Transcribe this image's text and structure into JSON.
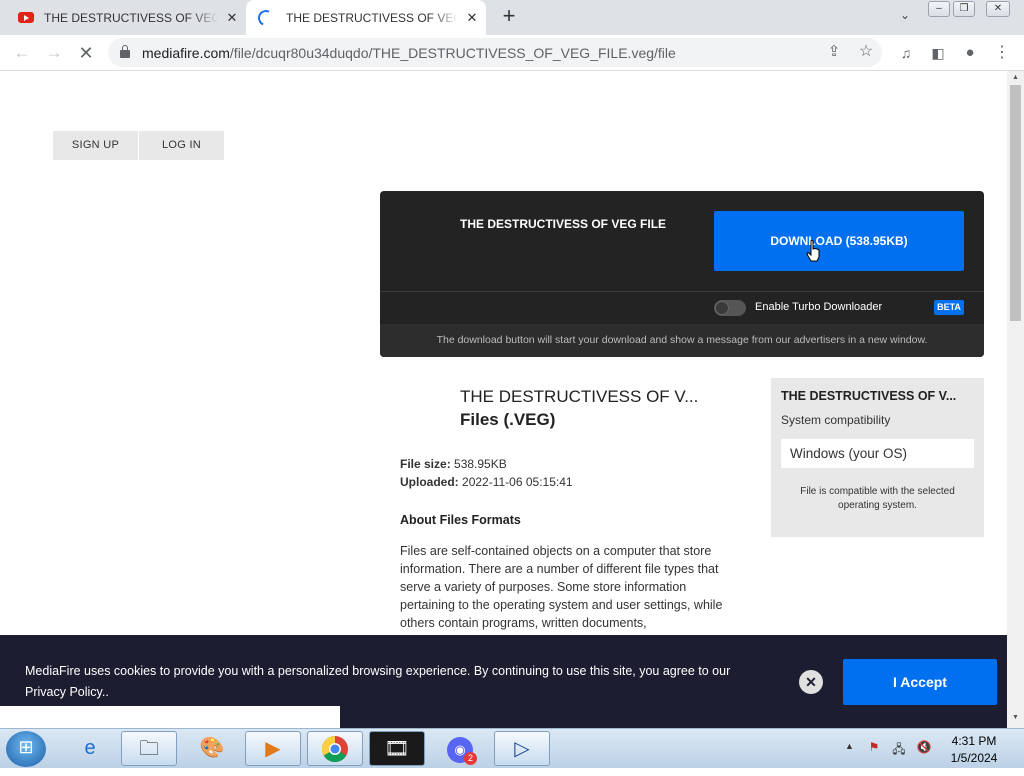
{
  "browser": {
    "tabs": [
      {
        "title": "THE DESTRUCTIVESS OF VEG FILE"
      },
      {
        "title": "THE DESTRUCTIVESS OF VEG FILE"
      }
    ],
    "url_host": "mediafire.com",
    "url_path": "/file/dcuqr80u34duqdo/THE_DESTRUCTIVESS_OF_VEG_FILE.veg/file"
  },
  "page": {
    "auth": {
      "signup": "SIGN UP",
      "login": "LOG IN"
    },
    "download_card": {
      "title": "THE DESTRUCTIVESS OF VEG FILE",
      "button": "DOWNLOAD (538.95KB)",
      "turbo_label": "Enable Turbo Downloader",
      "beta": "BETA",
      "note": "The download button will start your download and show a message from our advertisers in a new window."
    },
    "file": {
      "name": "THE DESTRUCTIVESS OF V...",
      "type": "Files (.VEG)",
      "size_label": "File size:",
      "size": "538.95KB",
      "uploaded_label": "Uploaded:",
      "uploaded": "2022-11-06 05:15:41",
      "about_heading": "About Files Formats",
      "about_text": "Files are self-contained objects on a computer that store information. There are a number of different file types that serve a variety of purposes. Some store information pertaining to the operating system and user settings, while others contain programs, written documents,"
    },
    "compat": {
      "title": "THE DESTRUCTIVESS OF V...",
      "subtitle": "System compatibility",
      "os": "Windows (your OS)",
      "note": "File is compatible with the selected operating system."
    },
    "cookie": {
      "text": "MediaFire uses cookies to provide you with a personalized browsing experience. By continuing to use this site, you agree to our Privacy Policy..",
      "accept": "I Accept"
    }
  },
  "taskbar": {
    "time": "4:31 PM",
    "date": "1/5/2024",
    "icons": [
      "internet-explorer-icon",
      "file-explorer-icon",
      "paint-icon",
      "media-player-icon",
      "chrome-icon",
      "video-editor-icon",
      "discord-icon",
      "media-app-icon"
    ],
    "discord_badge": "2"
  },
  "colors": {
    "accent": "#0070f0",
    "card_bg": "#232323",
    "cookie_bg": "#1c1d30"
  }
}
